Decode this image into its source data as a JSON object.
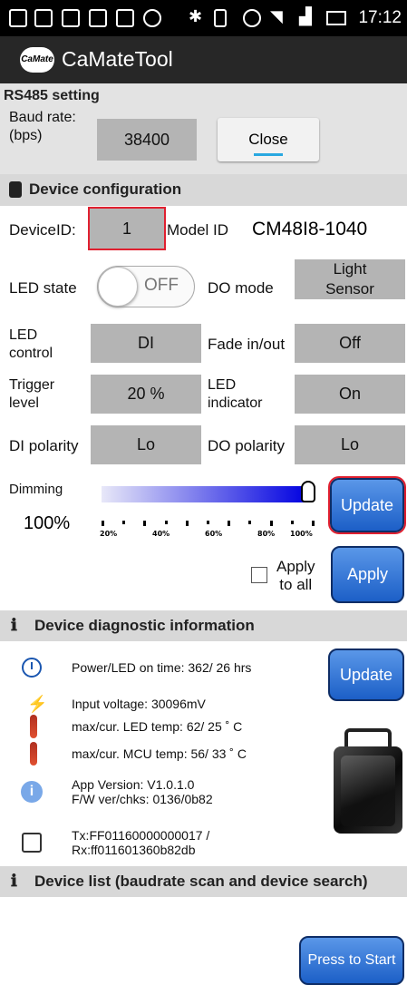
{
  "status": {
    "time": "17:12"
  },
  "app": {
    "logo": "CaMate",
    "title": "CaMateTool"
  },
  "rs485": {
    "header": "RS485 setting",
    "baud_label": "Baud rate:\n(bps)",
    "baud_value": "38400",
    "close_label": "Close"
  },
  "device_config": {
    "header": "Device configuration",
    "device_id_label": "DeviceID:",
    "device_id_value": "1",
    "model_id_label": "Model ID",
    "model_id_value": "CM48I8-1040",
    "led_state_label": "LED state",
    "led_state_value": "OFF",
    "do_mode_label": "DO mode",
    "do_mode_value": "Light\nSensor",
    "led_control_label": "LED\ncontrol",
    "led_control_value": "DI",
    "fade_label": "Fade in/out",
    "fade_value": "Off",
    "trigger_label": "Trigger\nlevel",
    "trigger_value": "20 %",
    "led_indicator_label": "LED\nindicator",
    "led_indicator_value": "On",
    "di_polarity_label": "DI polarity",
    "di_polarity_value": "Lo",
    "do_polarity_label": "DO polarity",
    "do_polarity_value": "Lo",
    "dimming_label": "Dimming",
    "dimming_value": "100%",
    "dimming_level": 1.0,
    "dimming_ticks": [
      "20%",
      "40%",
      "60%",
      "80%",
      "100%"
    ],
    "update_label": "Update",
    "apply_all_label": "Apply\nto all",
    "apply_label": "Apply"
  },
  "diagnostics": {
    "header": "Device diagnostic information",
    "power_time": "Power/LED on time: 362/ 26 hrs",
    "update_label": "Update",
    "input_voltage": "Input voltage: 30096mV",
    "led_temp": "max/cur. LED temp: 62/ 25 ˚ C",
    "mcu_temp": "max/cur. MCU temp: 56/ 33 ˚ C",
    "app_version": "App Version: V1.0.1.0",
    "fw_version": "F/W ver/chks: 0136/0b82",
    "tx": "Tx:FF01160000000017 /",
    "rx": "Rx:ff011601360b82db"
  },
  "device_list": {
    "header": "Device list (baudrate scan and device search)",
    "start_label": "Press to Start"
  },
  "colors": {
    "accent_blue": "#1c5fc7",
    "highlight_red": "#e02030",
    "section_gray": "#d8d8d8",
    "box_gray": "#b4b4b4"
  }
}
